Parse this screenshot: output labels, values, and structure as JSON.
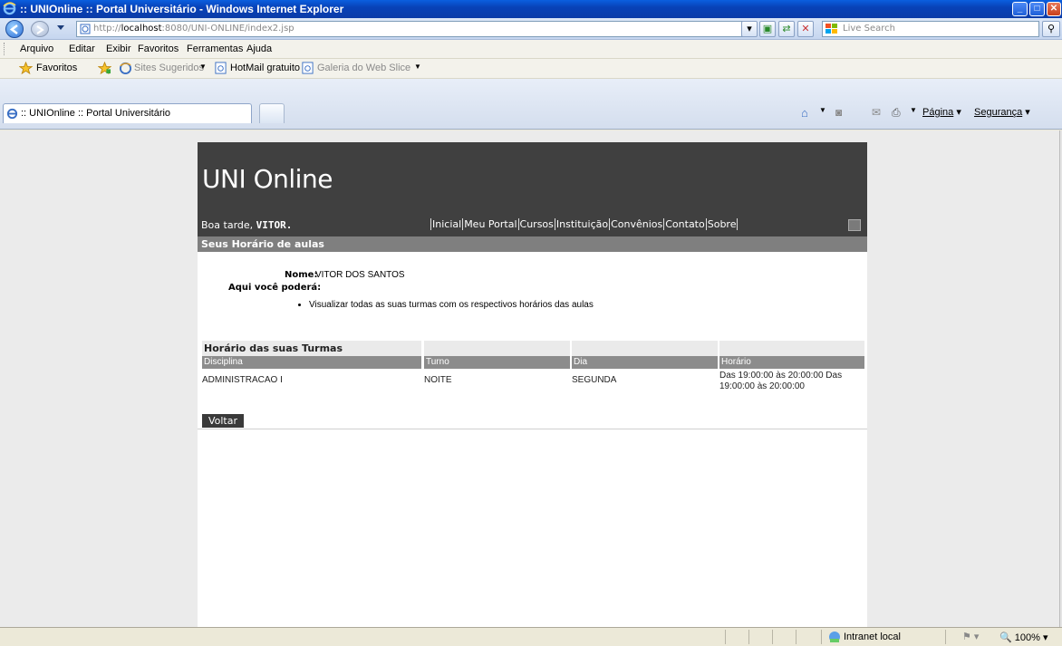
{
  "window": {
    "title": ":: UNIOnline :: Portal Universitário - Windows Internet Explorer",
    "minimize": "_",
    "maximize": "□",
    "close": "✕"
  },
  "address": {
    "url_prefix": "http://",
    "url_host": "localhost",
    "url_rest": ":8080/UNI-ONLINE/index2.jsp",
    "search_placeholder": "Live Search"
  },
  "menu": {
    "items": [
      "Arquivo",
      "Editar",
      "Exibir",
      "Favoritos",
      "Ferramentas",
      "Ajuda"
    ]
  },
  "favorites_bar": {
    "favorites_label": "Favoritos",
    "suggested_sites": "Sites Sugeridos",
    "hotmail": "HotMail gratuito",
    "web_slice": "Galeria do Web Slice"
  },
  "tabs": {
    "active_label": ":: UNIOnline :: Portal Universitário"
  },
  "command_bar": {
    "page": "Página",
    "security": "Segurança"
  },
  "site": {
    "title": "UNI Online",
    "greeting_prefix": "Boa tarde, ",
    "user": "VITOR.",
    "nav": [
      "Inicial",
      "Meu Portal",
      "Cursos",
      "Instituição",
      "Convênios",
      "Contato",
      "Sobre"
    ],
    "section_title": "Seus Horário de aulas",
    "name_label": "Nome:",
    "name_value": "VITOR DOS SANTOS",
    "can_label": "Aqui você poderá:",
    "can_items": [
      "Visualizar todas as suas turmas com os respectivos horários das aulas"
    ],
    "schedule": {
      "caption": "Horário das suas Turmas",
      "headers": [
        "Disciplina",
        "Turno",
        "Dia",
        "Horário"
      ],
      "rows": [
        [
          "ADMINISTRACAO I",
          "NOITE",
          "SEGUNDA",
          "Das 19:00:00 às 20:00:00 Das 19:00:00 às 20:00:00"
        ]
      ]
    },
    "back_label": "Voltar"
  },
  "status": {
    "zone": "Intranet local",
    "zoom": "100%"
  }
}
